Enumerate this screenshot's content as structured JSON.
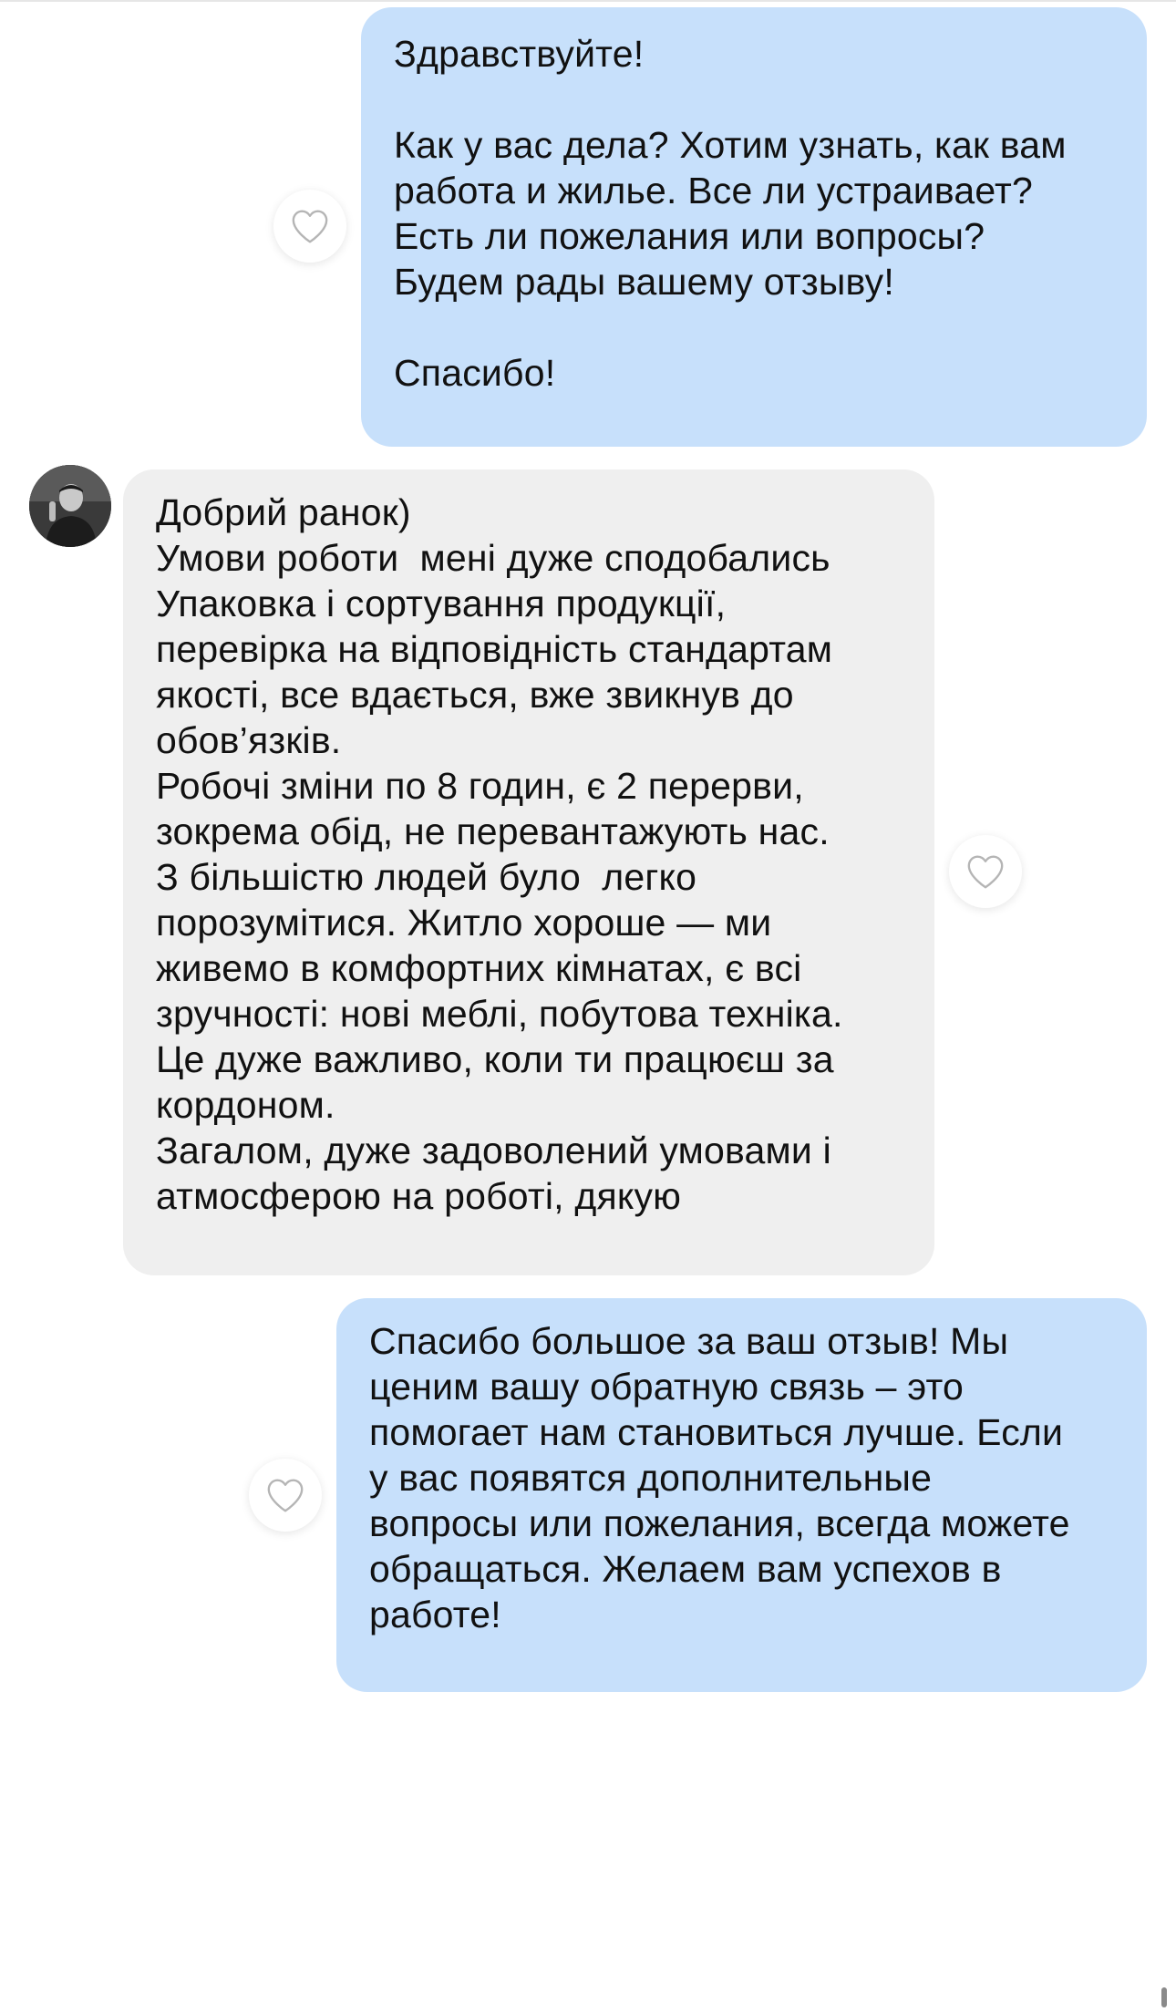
{
  "messages": [
    {
      "direction": "outgoing",
      "text": "Здравствуйте!\n\nКак у вас дела? Хотим узнать, как вам\nработа и жилье. Все ли устраивает?\nЕсть ли пожелания или вопросы?\nБудем рады вашему отзыву!\n\nСпасибо!"
    },
    {
      "direction": "incoming",
      "text": "Добрий ранок)\nУмови роботи  мені дуже сподобались\nУпаковка і сортування продукції,\nперевірка на відповідність стандартам\nякості, все вдається, вже звикнув до\nобов’язків.\nРобочі зміни по 8 годин, є 2 перерви,\nзокрема обід, не перевантажують нас.\nЗ більшістю людей було  легко\nпорозумітися. Житло хороше — ми\nживемо в комфортних кімнатах, є всі\nзручності: нові меблі, побутова техніка.\nЦе дуже важливо, коли ти працюєш за\nкордоном.\nЗагалом, дуже задоволений умовами і\nатмосферою на роботі, дякую"
    },
    {
      "direction": "outgoing",
      "text": "Спасибо большое за ваш отзыв! Мы\nценим вашу обратную связь – это\nпомогает нам становиться лучше. Если\nу вас появятся дополнительные\nвопросы или пожелания, всегда можете\nобращаться. Желаем вам успехов в\nработе!"
    }
  ],
  "icons": {
    "like": "heart-outline-icon",
    "avatar": "user-avatar"
  },
  "colors": {
    "outgoing_bubble": "#c7e0fb",
    "incoming_bubble": "#efefef",
    "heart_stroke": "#b5b5b5"
  }
}
